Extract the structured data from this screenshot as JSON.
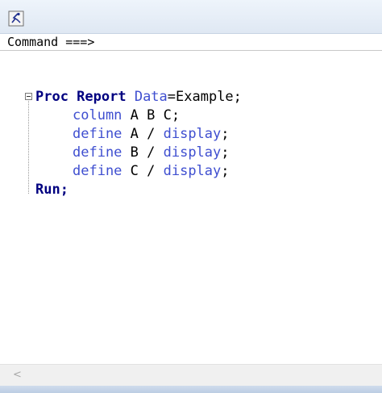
{
  "window": {
    "icon": "sas-program-editor-icon"
  },
  "command_bar": {
    "label": "Command ===>",
    "value": ""
  },
  "editor": {
    "lines": [
      [
        {
          "text": "Proc Report ",
          "style": "kw-bold"
        },
        {
          "text": "Data",
          "style": "kw-blue"
        },
        {
          "text": "=Example;",
          "style": "plain"
        }
      ],
      [
        {
          "text": "column ",
          "style": "kw-blue"
        },
        {
          "text": "A B C;",
          "style": "plain"
        }
      ],
      [
        {
          "text": "define ",
          "style": "kw-blue"
        },
        {
          "text": "A / ",
          "style": "plain"
        },
        {
          "text": "display",
          "style": "kw-blue"
        },
        {
          "text": ";",
          "style": "plain"
        }
      ],
      [
        {
          "text": "define ",
          "style": "kw-blue"
        },
        {
          "text": "B / ",
          "style": "plain"
        },
        {
          "text": "display",
          "style": "kw-blue"
        },
        {
          "text": ";",
          "style": "plain"
        }
      ],
      [
        {
          "text": "define ",
          "style": "kw-blue"
        },
        {
          "text": "C / ",
          "style": "plain"
        },
        {
          "text": "display",
          "style": "kw-blue"
        },
        {
          "text": ";",
          "style": "plain"
        }
      ],
      [
        {
          "text": "Run;",
          "style": "kw-bold"
        }
      ]
    ]
  },
  "scrollbar": {
    "left_arrow": "<"
  }
}
